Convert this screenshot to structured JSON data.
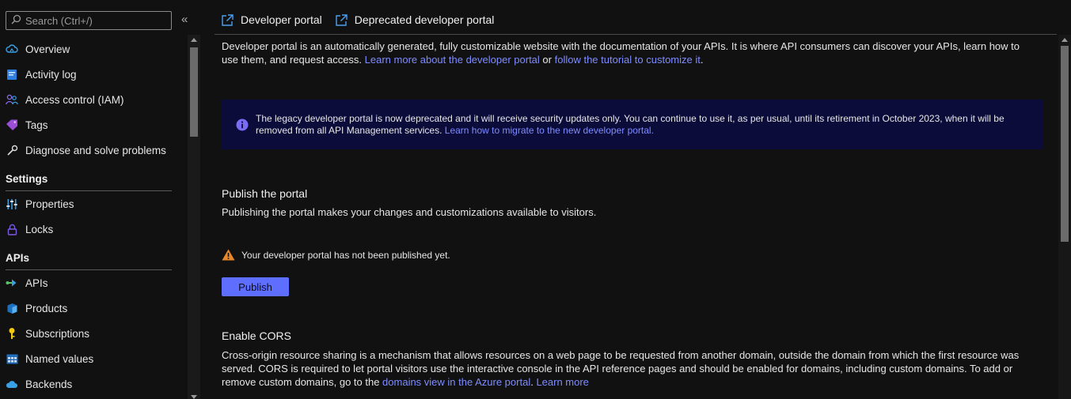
{
  "sidebar": {
    "search_placeholder": "Search (Ctrl+/)",
    "collapse_label": "«",
    "items": [
      {
        "label": "Overview",
        "icon": "cloud-icon"
      },
      {
        "label": "Activity log",
        "icon": "activity-log-icon"
      },
      {
        "label": "Access control (IAM)",
        "icon": "people-icon"
      },
      {
        "label": "Tags",
        "icon": "tag-icon"
      },
      {
        "label": "Diagnose and solve problems",
        "icon": "wrench-icon"
      }
    ],
    "settings_header": "Settings",
    "settings_items": [
      {
        "label": "Properties",
        "icon": "sliders-icon"
      },
      {
        "label": "Locks",
        "icon": "lock-icon"
      }
    ],
    "apis_header": "APIs",
    "apis_items": [
      {
        "label": "APIs",
        "icon": "api-arrow-icon"
      },
      {
        "label": "Products",
        "icon": "cube-icon"
      },
      {
        "label": "Subscriptions",
        "icon": "key-icon"
      },
      {
        "label": "Named values",
        "icon": "table-icon"
      },
      {
        "label": "Backends",
        "icon": "cloud-network-icon"
      }
    ]
  },
  "toolbar": {
    "developer_portal": "Developer portal",
    "deprecated_portal": "Deprecated developer portal"
  },
  "intro": {
    "text": "Developer portal is an automatically generated, fully customizable website with the documentation of your APIs. It is where API consumers can discover your APIs, learn how to use them, and request access. ",
    "link1": "Learn more about the developer portal",
    "or": " or ",
    "link2": "follow the tutorial to customize it",
    "end": "."
  },
  "banner": {
    "text": "The legacy developer portal is now deprecated and it will receive security updates only. You can continue to use it, as per usual, until its retirement in October 2023, when it will be removed from all API Management services. ",
    "link": "Learn how to migrate to the new developer portal."
  },
  "publish": {
    "title": "Publish the portal",
    "description": "Publishing the portal makes your changes and customizations available to visitors.",
    "warning": "Your developer portal has not been published yet.",
    "button": "Publish"
  },
  "cors": {
    "title": "Enable CORS",
    "text": "Cross-origin resource sharing is a mechanism that allows resources on a web page to be requested from another domain, outside the domain from which the first resource was served. CORS is required to let portal visitors use the interactive console in the API reference pages and should be enabled for domains, including custom domains. To add or remove custom domains, go to the ",
    "link1": "domains view in the Azure portal",
    "sep": ". ",
    "link2": "Learn more"
  },
  "colors": {
    "background": "#111111",
    "link": "#7f8cff",
    "banner_bg": "#0b0c3a",
    "primary_button": "#5e6fff",
    "warning": "#e8862a"
  }
}
